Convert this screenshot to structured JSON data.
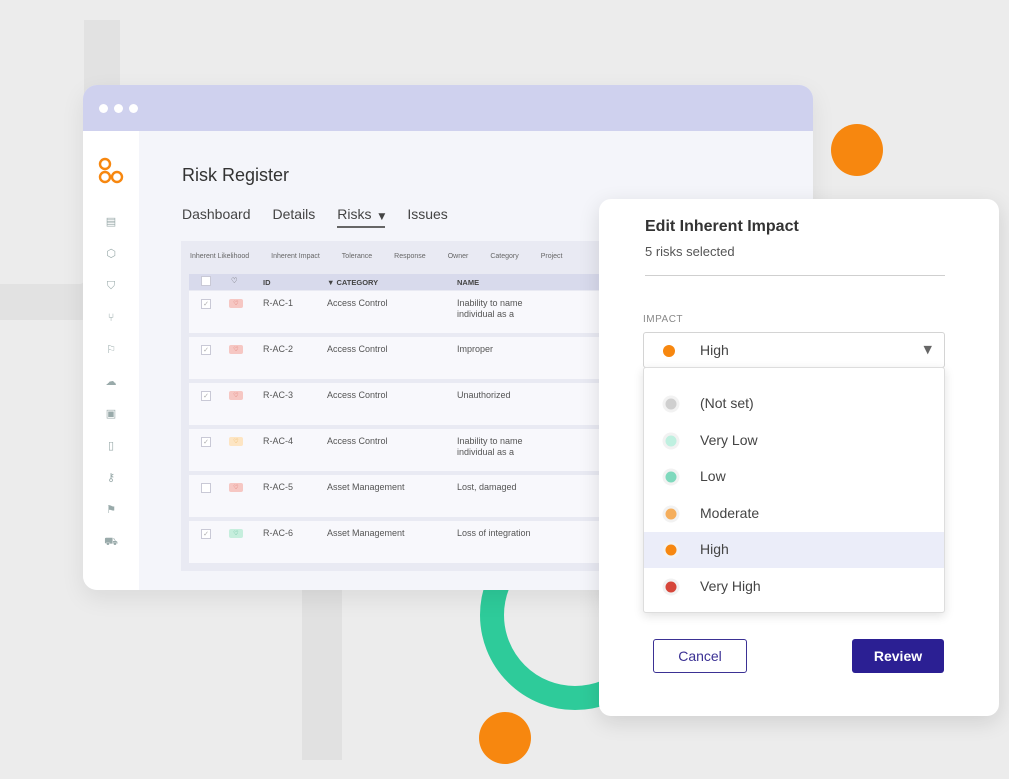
{
  "colors": {
    "accent_orange": "#f7870f",
    "accent_green": "#2ecb9a",
    "brand_purple": "#2b1f93",
    "titlebar": "#cfd1ee"
  },
  "app": {
    "logo_icon": "brand-logo-icon",
    "sidebar_icons": [
      "layout-icon",
      "cube-icon",
      "shield-icon",
      "git-branch-icon",
      "chat-flag-icon",
      "cloud-icon",
      "book-icon",
      "clipboard-icon",
      "key-icon",
      "flag-icon",
      "truck-icon"
    ]
  },
  "page": {
    "title": "Risk Register",
    "tabs": [
      {
        "label": "Dashboard",
        "active": false
      },
      {
        "label": "Details",
        "active": false
      },
      {
        "label": "Risks",
        "active": true,
        "caret": "▼"
      },
      {
        "label": "Issues",
        "active": false
      }
    ]
  },
  "table": {
    "column_toggles": [
      "Inherent Likelihood",
      "Inherent Impact",
      "Tolerance",
      "Response",
      "Owner",
      "Category",
      "Project"
    ],
    "headers": {
      "heart_icon": "heart-icon",
      "id": "ID",
      "category": "▼ CATEGORY",
      "name": "NAME"
    },
    "rows": [
      {
        "checked": true,
        "badge": "red",
        "id": "R-AC-1",
        "category": "Access Control",
        "name": "Inability to name individual as a"
      },
      {
        "checked": true,
        "badge": "red",
        "id": "R-AC-2",
        "category": "Access Control",
        "name": "Improper"
      },
      {
        "checked": true,
        "badge": "red",
        "id": "R-AC-3",
        "category": "Access Control",
        "name": "Unauthorized"
      },
      {
        "checked": true,
        "badge": "yellow",
        "id": "R-AC-4",
        "category": "Access Control",
        "name": "Inability to name individual as a"
      },
      {
        "checked": false,
        "badge": "red",
        "id": "R-AC-5",
        "category": "Asset Management",
        "name": "Lost, damaged"
      },
      {
        "checked": true,
        "badge": "green",
        "id": "R-AC-6",
        "category": "Asset Management",
        "name": "Loss of integration"
      }
    ]
  },
  "panel": {
    "title": "Edit Inherent Impact",
    "subtitle": "5 risks selected",
    "field_label": "IMPACT",
    "selected_value": "High",
    "selected_color": "#f7870f",
    "options": [
      {
        "label": "(Not set)",
        "color": "#cfcfcf",
        "selected": false
      },
      {
        "label": "Very Low",
        "color": "#bff0e0",
        "selected": false
      },
      {
        "label": "Low",
        "color": "#7fd9bd",
        "selected": false
      },
      {
        "label": "Moderate",
        "color": "#f5ae5c",
        "selected": false
      },
      {
        "label": "High",
        "color": "#f7870f",
        "selected": true
      },
      {
        "label": "Very High",
        "color": "#d6463a",
        "selected": false
      }
    ],
    "cancel_label": "Cancel",
    "review_label": "Review"
  }
}
